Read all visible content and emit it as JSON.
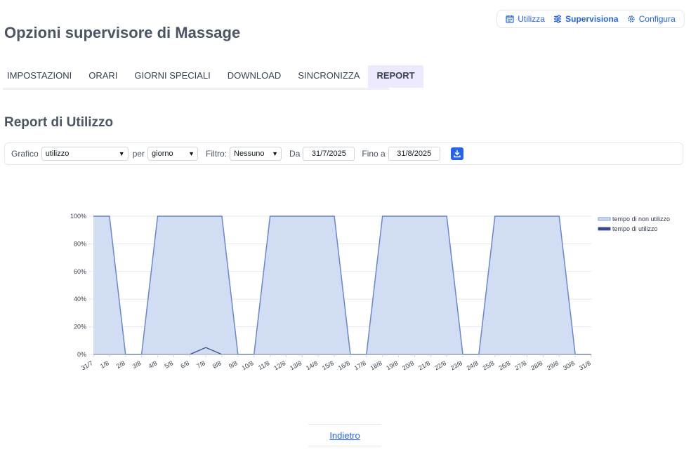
{
  "modes": [
    {
      "label": "Utilizza",
      "icon": "calendar-icon",
      "active": false
    },
    {
      "label": "Supervisiona",
      "icon": "sliders-icon",
      "active": true
    },
    {
      "label": "Configura",
      "icon": "gear-icon",
      "active": false
    }
  ],
  "page_title": "Opzioni supervisore di Massage",
  "tabs": [
    {
      "label": "IMPOSTAZIONI"
    },
    {
      "label": "ORARI"
    },
    {
      "label": "GIORNI SPECIALI"
    },
    {
      "label": "DOWNLOAD"
    },
    {
      "label": "SINCRONIZZA"
    },
    {
      "label": "REPORT",
      "active": true
    }
  ],
  "section_title": "Report di Utilizzo",
  "filters": {
    "grafico_label": "Grafico",
    "grafico_value": "utilizzo",
    "per_label": "per",
    "per_value": "giorno",
    "filtro_label": "Filtro:",
    "filtro_value": "Nessuno",
    "da_label": "Da",
    "da_value": "31/7/2025",
    "fino_label": "Fino a",
    "fino_value": "31/8/2025",
    "download_icon": "download-icon"
  },
  "colors": {
    "accent": "#2563eb",
    "fill": "#cfdbf1",
    "line": "#6b86cd",
    "usage_line": "#3a4a8a"
  },
  "chart_data": {
    "type": "area",
    "x": [
      "31/7",
      "1/8",
      "2/8",
      "3/8",
      "4/8",
      "5/8",
      "6/8",
      "7/8",
      "8/8",
      "9/8",
      "10/8",
      "11/8",
      "12/8",
      "13/8",
      "14/8",
      "15/8",
      "16/8",
      "17/8",
      "18/8",
      "19/8",
      "20/8",
      "21/8",
      "22/8",
      "23/8",
      "24/8",
      "25/8",
      "26/8",
      "27/8",
      "28/8",
      "29/8",
      "30/8",
      "31/8"
    ],
    "yticks": [
      "0%",
      "20%",
      "40%",
      "60%",
      "80%",
      "100%"
    ],
    "ylim": [
      0,
      100
    ],
    "grid": true,
    "legend_position": "right",
    "series": [
      {
        "name": "tempo di non utilizzo",
        "values": [
          100,
          100,
          0,
          0,
          100,
          100,
          100,
          100,
          100,
          0,
          0,
          100,
          100,
          100,
          100,
          100,
          0,
          0,
          100,
          100,
          100,
          100,
          100,
          0,
          0,
          100,
          100,
          100,
          100,
          100,
          0,
          0
        ]
      },
      {
        "name": "tempo di utilizzo",
        "values": [
          0,
          0,
          0,
          0,
          0,
          0,
          0,
          5,
          0,
          0,
          0,
          0,
          0,
          0,
          0,
          0,
          0,
          0,
          0,
          0,
          0,
          0,
          0,
          0,
          0,
          0,
          0,
          0,
          0,
          0,
          0,
          0
        ]
      }
    ]
  },
  "back_label": "Indietro"
}
